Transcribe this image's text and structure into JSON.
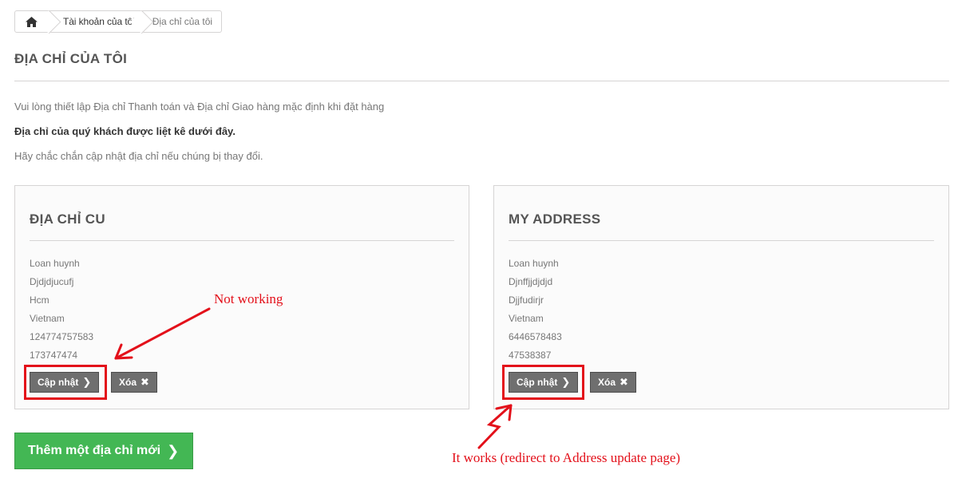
{
  "breadcrumb": {
    "home_icon": "home-icon",
    "items": [
      "Tài khoản của tôi",
      "Địa chỉ của tôi"
    ]
  },
  "page_title": "ĐỊA CHỈ CỦA TÔI",
  "info": {
    "line1": "Vui lòng thiết lập Địa chỉ Thanh toán và Địa chỉ Giao hàng mặc định khi đặt hàng",
    "line2": "Địa chỉ của quý khách được liệt kê dưới đây.",
    "line3": "Hãy chắc chắn cập nhật địa chỉ nếu chúng bị thay đổi."
  },
  "addresses": [
    {
      "title": "ĐỊA CHỈ CU",
      "lines": [
        "Loan huynh",
        "Djdjdjucufj",
        "Hcm",
        "Vietnam",
        "124774757583",
        "173747474"
      ],
      "update_label": "Cập nhật",
      "delete_label": "Xóa"
    },
    {
      "title": "MY ADDRESS",
      "lines": [
        "Loan huynh",
        "Djnffjjdjdjd",
        "Djjfudirjr",
        "Vietnam",
        "6446578483",
        "47538387"
      ],
      "update_label": "Cập nhật",
      "delete_label": "Xóa"
    }
  ],
  "add_button_label": "Thêm một địa chỉ mới",
  "annotations": {
    "not_working": "Not working",
    "it_works": "It works (redirect to Address update page)"
  },
  "colors": {
    "annotation_red": "#e3101a",
    "add_button_green": "#43b754",
    "button_gray": "#6f6f6f"
  }
}
